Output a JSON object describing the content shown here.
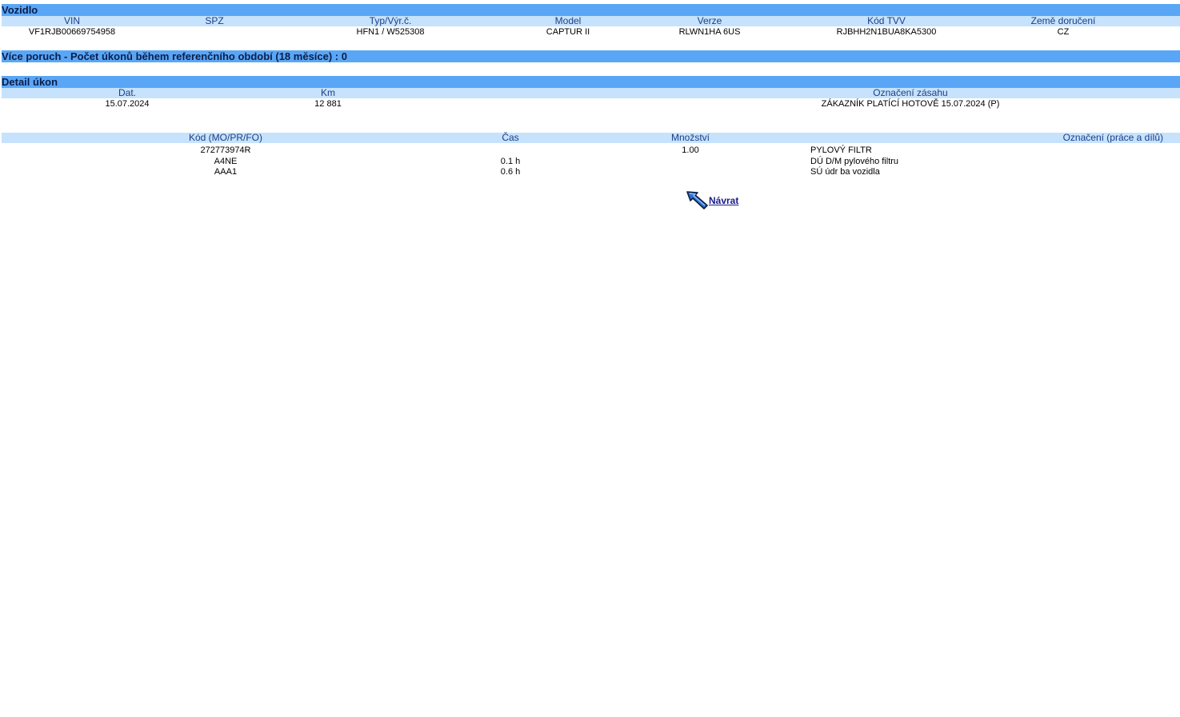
{
  "vehicle": {
    "title": "Vozidlo",
    "headers": {
      "vin": "VIN",
      "spz": "SPZ",
      "type": "Typ/Výr.č.",
      "model": "Model",
      "version": "Verze",
      "tvv": "Kód TVV",
      "country": "Země doručení"
    },
    "values": {
      "vin": "VF1RJB00669754958",
      "spz": "",
      "type": "HFN1 / W525308",
      "model": "CAPTUR II",
      "version": "RLWN1HA 6US",
      "tvv": "RJBHH2N1BUA8KA5300",
      "country": "CZ"
    }
  },
  "failures": {
    "title": "Více poruch - Počet úkonů během referenčního období (18 měsíce) : 0"
  },
  "detail": {
    "title": "Detail úkon",
    "headers": {
      "date": "Dat.",
      "km": "Km",
      "label": "Označení zásahu"
    },
    "values": {
      "date": "15.07.2024",
      "km": "12 881",
      "label": "ZÁKAZNÍK PLATÍCÍ HOTOVĚ 15.07.2024 (P)"
    }
  },
  "items": {
    "headers": {
      "code": "Kód (MO/PR/FO)",
      "time": "Čas",
      "qty": "Množství",
      "label": "Označení (práce a dílů)"
    },
    "rows": [
      {
        "code": "272773974R",
        "time": "",
        "qty": "1.00",
        "label": "PYLOVÝ FILTR"
      },
      {
        "code": "A4NE",
        "time": "0.1 h",
        "qty": "",
        "label": "DÚ D/M pylového filtru"
      },
      {
        "code": "AAA1",
        "time": "0.6 h",
        "qty": "",
        "label": "SÚ údr ba vozidla"
      }
    ]
  },
  "back": {
    "label": "Návrat",
    "icon": "back-arrow-icon"
  }
}
